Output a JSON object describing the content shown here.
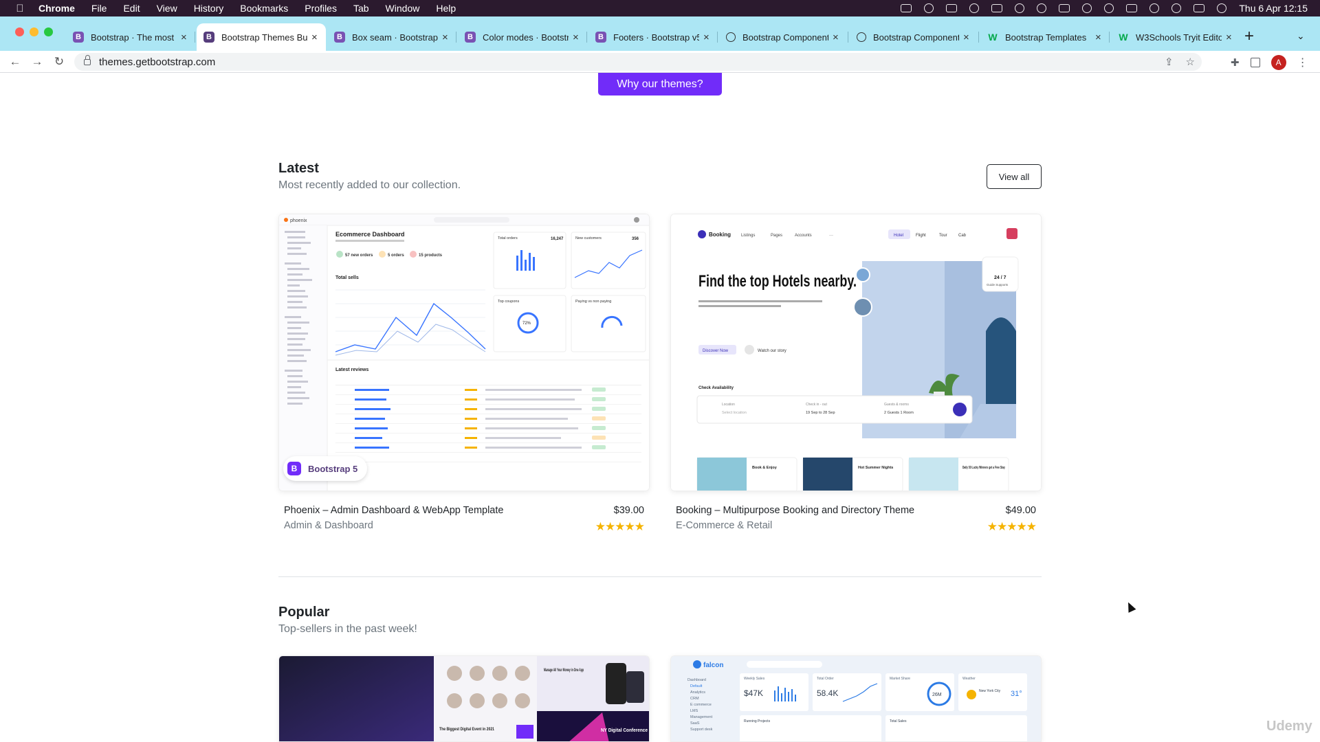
{
  "menubar": {
    "app": "Chrome",
    "items": [
      "File",
      "Edit",
      "View",
      "History",
      "Bookmarks",
      "Profiles",
      "Tab",
      "Window",
      "Help"
    ],
    "clock": "Thu 6 Apr  12:15"
  },
  "tabs": [
    {
      "title": "Bootstrap · The most p",
      "favicon": "bootstrap-icon"
    },
    {
      "title": "Bootstrap Themes Bui",
      "favicon": "bootstrap-icon",
      "active": true
    },
    {
      "title": "Box seam · Bootstrap",
      "favicon": "bootstrap-icon"
    },
    {
      "title": "Color modes · Bootstr",
      "favicon": "bootstrap-icon"
    },
    {
      "title": "Footers · Bootstrap v5",
      "favicon": "bootstrap-icon"
    },
    {
      "title": "Bootstrap Component",
      "favicon": "globe-icon"
    },
    {
      "title": "Bootstrap Component",
      "favicon": "globe-icon"
    },
    {
      "title": "Bootstrap Templates",
      "favicon": "w3schools-icon"
    },
    {
      "title": "W3Schools Tryit Edito",
      "favicon": "w3schools-icon"
    }
  ],
  "toolbar": {
    "url": "themes.getbootstrap.com",
    "avatar_letter": "A"
  },
  "page": {
    "why_button": "Why our themes?",
    "latest": {
      "title": "Latest",
      "subtitle": "Most recently added to our collection.",
      "view_all": "View all"
    },
    "popular": {
      "title": "Popular",
      "subtitle": "Top-sellers in the past week!"
    },
    "cards": [
      {
        "name": "Phoenix – Admin Dashboard & WebApp Template",
        "category": "Admin & Dashboard",
        "price": "$39.00",
        "stars": "★★★★★",
        "badge": "Bootstrap 5",
        "preview": {
          "brand": "phoenix",
          "heading": "Ecommerce Dashboard",
          "stats": [
            "57 new orders",
            "5 orders",
            "15 products"
          ],
          "total_sells": "Total sells",
          "latest_reviews": "Latest reviews",
          "total_orders": "Total orders",
          "total_orders_value": "16,247",
          "new_customers": "New customers",
          "new_customers_value": "356",
          "top_coupons": "Top coupons",
          "coupon_pct": "72%",
          "paying": "Paying vs non paying"
        }
      },
      {
        "name": "Booking – Multipurpose Booking and Directory Theme",
        "category": "E-Commerce & Retail",
        "price": "$49.00",
        "stars": "★★★★★",
        "preview": {
          "brand": "Booking",
          "nav": [
            "Listings",
            "Pages",
            "Accounts",
            "···"
          ],
          "pills": [
            "Hotel",
            "Flight",
            "Tour",
            "Cab"
          ],
          "hero": "Find the top Hotels nearby.",
          "hero_sub": "We bring you not only a stay option, but an experience in your budget to enjoy the luxury.",
          "discover": "Discover Now",
          "watch": "Watch our story",
          "support": "24 / 7",
          "support_sub": "Guide Supports",
          "check": "Check Availability",
          "location_label": "Location",
          "location_ph": "Select location",
          "checkin_label": "Check in - out",
          "checkin_value": "19 Sep to 28 Sep",
          "guests_label": "Guests & rooms",
          "guests_value": "2 Guests 1 Room",
          "promos": [
            {
              "title": "Book & Enjoy",
              "sub": "20% Off on the best available room rate"
            },
            {
              "title": "Hot Summer Nights",
              "sub": "Up to 3 nights free!"
            },
            {
              "title": "Daily 50 Lucky Winners get a Free Stay",
              "sub": "Valid till 15 Nov"
            }
          ]
        }
      }
    ],
    "popular_cards": [
      {
        "preview": {
          "tile1": "Manage All Your Money in One App",
          "tile2": "The Biggest Digital Event in 2021",
          "tile3": "NY Digital Conference"
        }
      },
      {
        "preview": {
          "brand": "falcon",
          "weekly": "Weekly Sales",
          "weekly_value": "$47K",
          "total_order": "Total Order",
          "total_order_value": "58.4K",
          "market": "Market Share",
          "market_value": "26M",
          "weather": "Weather",
          "weather_city": "New York City",
          "weather_temp": "31°",
          "running": "Running Projects",
          "total_sales": "Total Sales",
          "nav": [
            "Dashboard",
            "Default",
            "Analytics",
            "CRM",
            "E commerce",
            "LMS",
            "Management",
            "SaaS",
            "Support desk"
          ]
        }
      }
    ]
  },
  "watermark": "Udemy",
  "colors": {
    "accent": "#712cf9",
    "star": "#f5b301",
    "tabstrip": "#ace6f4"
  }
}
